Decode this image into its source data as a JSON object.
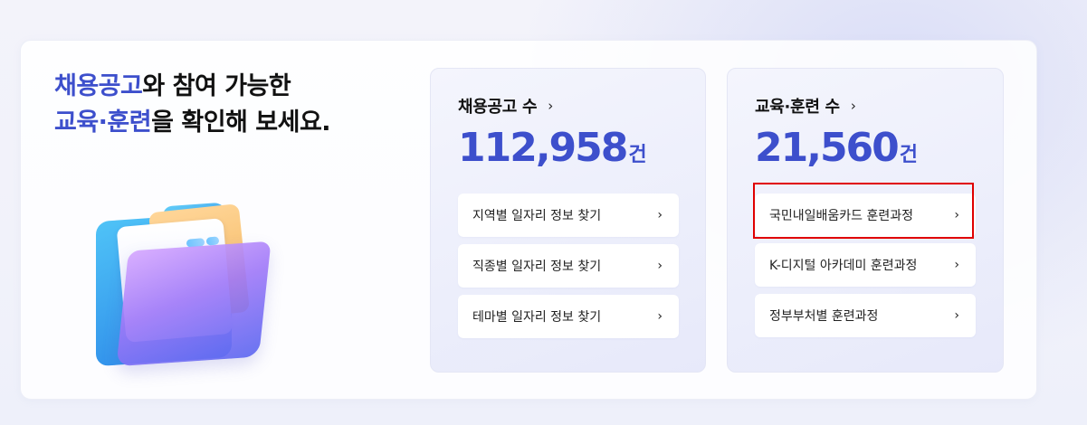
{
  "headline": {
    "line1_highlight": "채용공고",
    "line1_rest": "와 참여 가능한",
    "line2_highlight": "교육·훈련",
    "line2_rest": "을 확인해 보세요."
  },
  "jobs_card": {
    "title": "채용공고 수",
    "title_chevron": "›",
    "count": "112,958",
    "unit": "건",
    "links": [
      {
        "label": "지역별 일자리 정보 찾기",
        "chevron": "›"
      },
      {
        "label": "직종별 일자리 정보 찾기",
        "chevron": "›"
      },
      {
        "label": "테마별 일자리 정보 찾기",
        "chevron": "›"
      }
    ]
  },
  "training_card": {
    "title": "교육·훈련 수",
    "title_chevron": "›",
    "count": "21,560",
    "unit": "건",
    "links": [
      {
        "label": "국민내일배움카드 훈련과정",
        "chevron": "›"
      },
      {
        "label": "K-디지털 아카데미 훈련과정",
        "chevron": "›"
      },
      {
        "label": "정부부처별 훈련과정",
        "chevron": "›"
      }
    ]
  },
  "colors": {
    "accent": "#3d4fcc",
    "highlight_box": "#e00000"
  },
  "icons": {
    "illustration": "folder-documents-icon",
    "chevron": "chevron-right-icon"
  }
}
